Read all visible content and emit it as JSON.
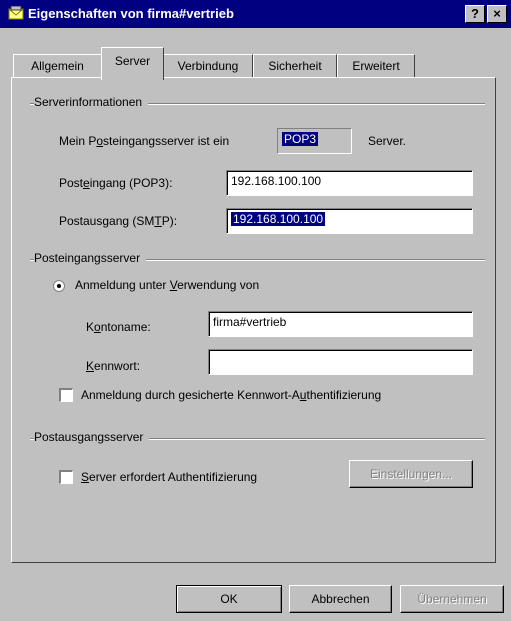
{
  "window": {
    "title": "Eigenschaften von firma#vertrieb",
    "help_button": "?",
    "close_button": "×"
  },
  "tabs": [
    {
      "label": "Allgemein"
    },
    {
      "label": "Server"
    },
    {
      "label": "Verbindung"
    },
    {
      "label": "Sicherheit"
    },
    {
      "label": "Erweitert"
    }
  ],
  "server_info": {
    "section_title": "Serverinformationen",
    "incoming_type_label": "Mein Posteingangsserver ist ein",
    "incoming_type_value": "POP3",
    "incoming_type_suffix": "Server.",
    "incoming_label": "Posteingang (POP3):",
    "incoming_value": "192.168.100.100",
    "outgoing_label": "Postausgang (SMTP):",
    "outgoing_value": "192.168.100.100"
  },
  "incoming_server": {
    "section_title": "Posteingangsserver",
    "login_radio_label": "Anmeldung unter Verwendung von",
    "account_label": "Kontoname:",
    "account_value": "firma#vertrieb",
    "password_label": "Kennwort:",
    "password_value": "",
    "spa_label": "Anmeldung durch gesicherte Kennwort-Authentifizierung"
  },
  "outgoing_server": {
    "section_title": "Postausgangsserver",
    "auth_label": "Server erfordert Authentifizierung",
    "settings_button": "Einstellungen..."
  },
  "buttons": {
    "ok": "OK",
    "cancel": "Abbrechen",
    "apply": "Übernehmen"
  }
}
